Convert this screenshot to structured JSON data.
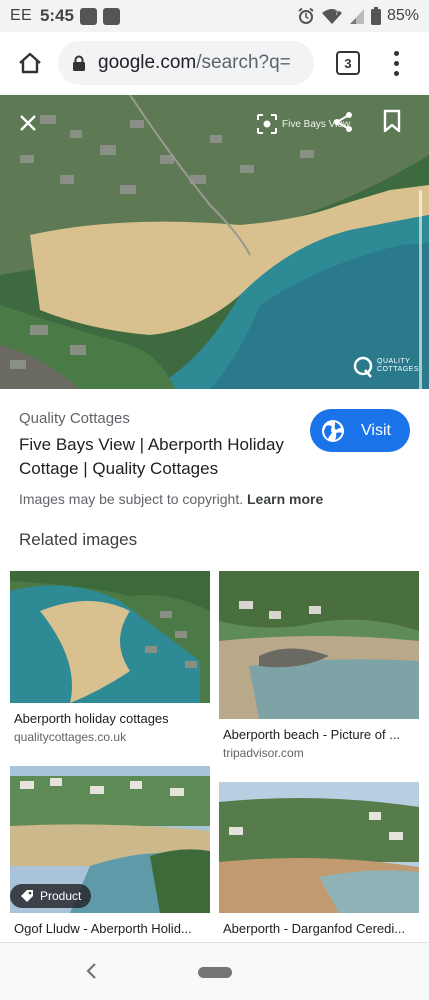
{
  "status_bar": {
    "carrier": "EE",
    "time": "5:45",
    "battery": "85%",
    "icons": [
      "alarm-icon",
      "wifi-icon",
      "signal-icon",
      "battery-icon"
    ]
  },
  "browser": {
    "url_domain": "google.com",
    "url_path": "/search?q=",
    "tab_count": "3"
  },
  "viewer": {
    "lens_label": "Five Bays View",
    "watermark": [
      "QUALITY",
      "COTTAGES"
    ]
  },
  "result": {
    "source": "Quality Cottages",
    "title": "Five Bays View | Aberporth Holiday Cottage | Quality Cottages",
    "visit_label": "Visit",
    "copyright_text": "Images may be subject to copyright.",
    "learn_more": "Learn more"
  },
  "related": {
    "heading": "Related images",
    "items": [
      {
        "caption": "Aberporth holiday cottages",
        "domain": "qualitycottages.co.uk"
      },
      {
        "caption": "Aberporth beach - Picture of ...",
        "domain": "tripadvisor.com"
      },
      {
        "caption": "Ogof Lludw - Aberporth Holid...",
        "domain": "",
        "badge": "Product"
      },
      {
        "caption": "Aberporth - Darganfod Ceredi...",
        "domain": ""
      }
    ]
  },
  "colors": {
    "accent": "#1a73e8",
    "sea": "#2e8b95",
    "sand": "#d9c08f"
  }
}
